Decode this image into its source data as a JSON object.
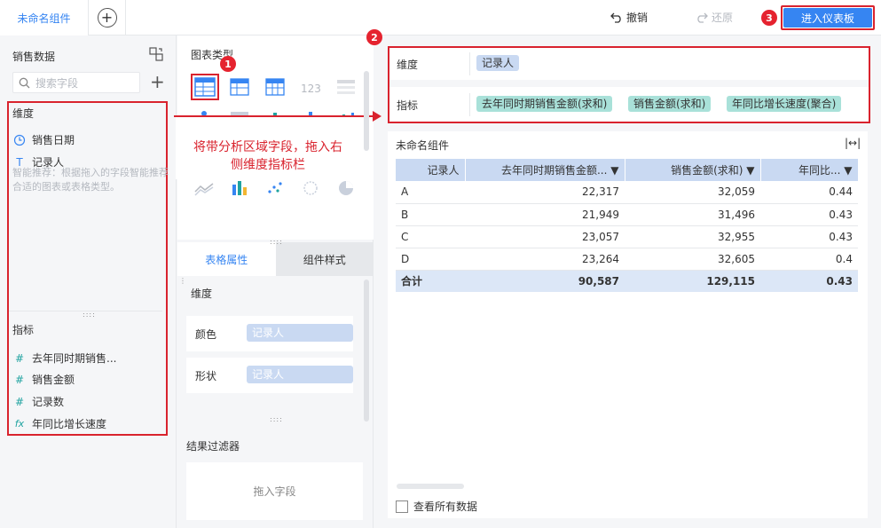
{
  "topbar": {
    "tab_label": "未命名组件",
    "add_tab_symbol": "+",
    "undo_label": "撤销",
    "redo_label": "还原",
    "enter_dashboard_label": "进入仪表板"
  },
  "badges": {
    "b1": "1",
    "b2": "2",
    "b3": "3"
  },
  "left": {
    "title": "销售数据",
    "search_placeholder": "搜索字段",
    "dim_label": "维度",
    "dimensions": [
      {
        "icon": "clock-icon",
        "label": "销售日期"
      },
      {
        "icon": "text-icon",
        "label": "记录人"
      }
    ],
    "measure_label": "指标",
    "measures": [
      {
        "icon": "hash-icon",
        "label": "去年同时期销售..."
      },
      {
        "icon": "hash-icon",
        "label": "销售金额"
      },
      {
        "icon": "hash-icon",
        "label": "记录数"
      },
      {
        "icon": "fx-icon",
        "label": "年同比增长速度"
      }
    ]
  },
  "middle": {
    "chart_types_title": "图表类型",
    "smart_tip": "智能推荐：根据拖入的字段智能推荐合适的图表或表格类型。",
    "tab_table_props": "表格属性",
    "tab_component_style": "组件样式",
    "dim_label": "维度",
    "color_label": "颜色",
    "color_value": "记录人",
    "shape_label": "形状",
    "shape_value": "记录人",
    "filter_title": "结果过滤器",
    "filter_placeholder": "拖入字段"
  },
  "annotation": {
    "text": "将带分析区域字段，拖入右侧维度指标栏"
  },
  "right": {
    "dim_label": "维度",
    "dim_chip": "记录人",
    "measure_label": "指标",
    "measure_chips": [
      "去年同时期销售金额(求和)",
      "销售金额(求和)",
      "年同比增长速度(聚合)"
    ],
    "table_title": "未命名组件",
    "show_all": "查看所有数据"
  },
  "table": {
    "headers": [
      "记录人",
      "去年同时期销售金额...",
      "销售金额(求和)",
      "年同比..."
    ],
    "rows": [
      [
        "A",
        "22,317",
        "32,059",
        "0.44"
      ],
      [
        "B",
        "21,949",
        "31,496",
        "0.43"
      ],
      [
        "C",
        "23,057",
        "32,955",
        "0.43"
      ],
      [
        "D",
        "23,264",
        "32,605",
        "0.4"
      ]
    ],
    "total": [
      "合计",
      "90,587",
      "129,115",
      "0.43"
    ]
  },
  "colors": {
    "accent": "#3685f2",
    "annotation_red": "#d9232e",
    "dim_chip": "#c9d9f2",
    "measure_chip": "#a9e1d9"
  }
}
